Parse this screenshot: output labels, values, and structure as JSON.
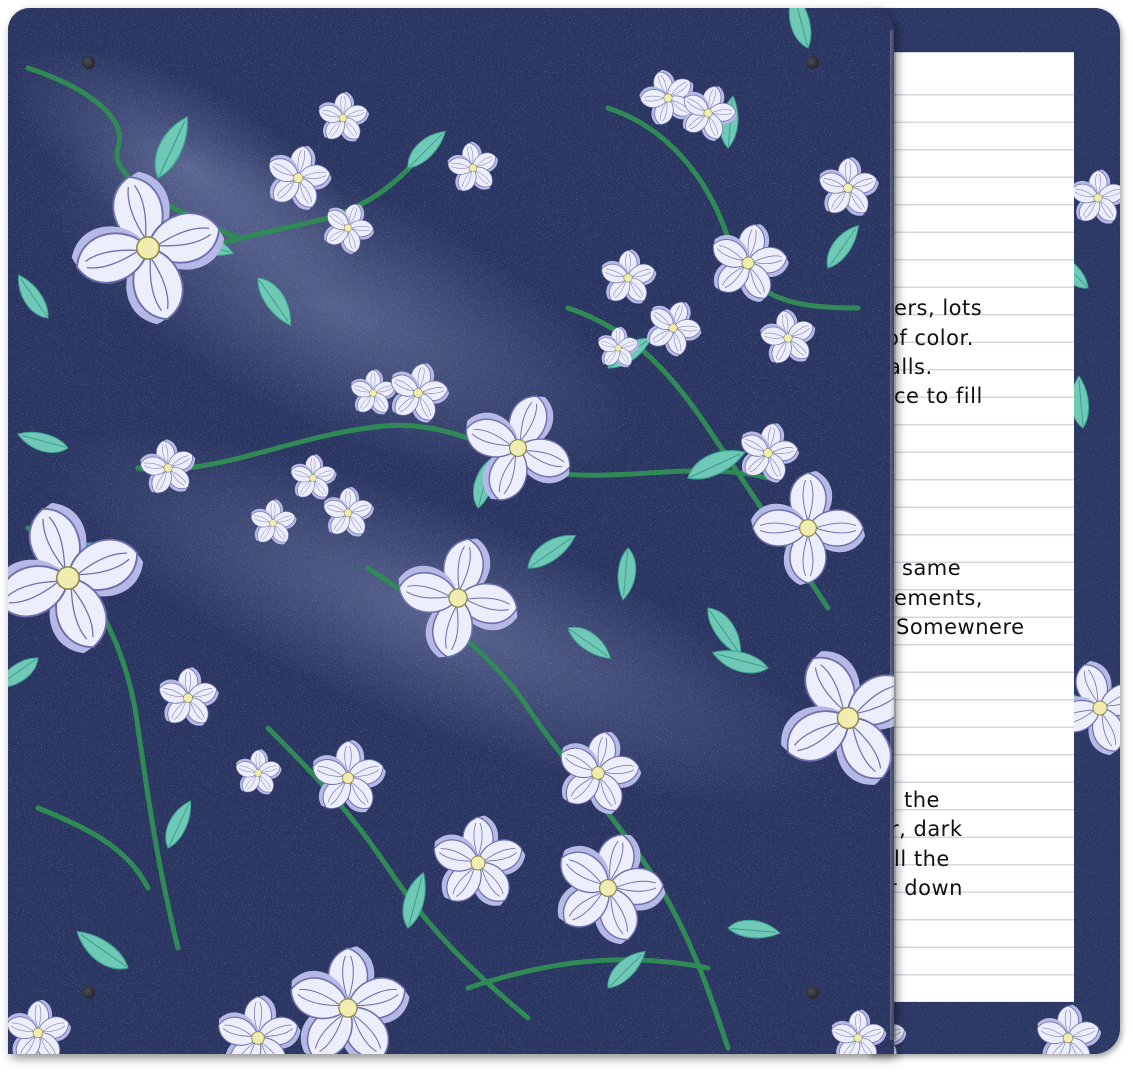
{
  "palette": {
    "navy": "#2a3561",
    "navy_light": "#3c4a80",
    "speckle": "#7d89b3",
    "leaf": "#6fc9b6",
    "leaf_dark": "#3fa192",
    "vine": "#2f8a55",
    "petal": "#eceefb",
    "petal_shadow": "#b6b9e6",
    "petal_line": "#6d6fae",
    "center": "#f1ecb0",
    "paper": "#ffffff",
    "paper_line": "#d4d8de",
    "ink": "#111111"
  },
  "notes": {
    "lines": [
      "ers, lots",
      "of color.",
      "alls.",
      "ce to fill",
      "same",
      "ements,",
      "Somewnere",
      "the",
      "r, dark",
      "ll the",
      "r down"
    ]
  },
  "icons": {
    "screw": "screw-icon",
    "flower": "dogwood-flower-icon",
    "leaf": "leaf-icon"
  }
}
